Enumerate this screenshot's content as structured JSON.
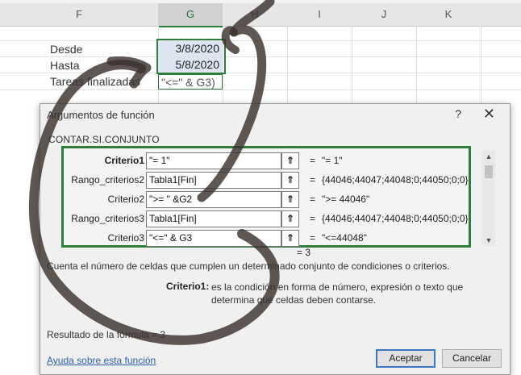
{
  "sheet": {
    "columns": [
      "F",
      "G",
      "H",
      "I",
      "J",
      "K"
    ],
    "selected_column": "G",
    "labels": [
      "Desde",
      "Hasta",
      "Tareas finalizadas"
    ],
    "g_values": [
      "3/8/2020",
      "5/8/2020"
    ],
    "g3_formula": "\"<=\" & G3)"
  },
  "dialog": {
    "title": "Argumentos de función",
    "help_glyph": "?",
    "close_glyph": "✕",
    "function_name": "CONTAR.SI.CONJUNTO",
    "args": [
      {
        "label": "Criterio1",
        "bold": true,
        "input": "\"= 1\"",
        "result": "\"= 1\""
      },
      {
        "label": "Rango_criterios2",
        "bold": false,
        "input": "Tabla1[Fin]",
        "result": "{44046;44047;44048;0;44050;0;0}"
      },
      {
        "label": "Criterio2",
        "bold": false,
        "input": "\">= \" &G2",
        "result": "\">= 44046\""
      },
      {
        "label": "Rango_criterios3",
        "bold": false,
        "input": "Tabla1[Fin]",
        "result": "{44046;44047;44048;0;44050;0;0}"
      },
      {
        "label": "Criterio3",
        "bold": false,
        "input": "\"<=\" & G3",
        "result": "\"<=44048\""
      }
    ],
    "ref_button_glyph": "⇑",
    "equals": "=",
    "total": "= 3",
    "description": "Cuenta el número de celdas que cumplen un determinado conjunto de condiciones o criterios.",
    "arg_desc_label": "Criterio1:",
    "arg_desc_text": "es la condición en forma de número, expresión o texto que determina qué celdas deben contarse.",
    "result_text": "Resultado de la fórmula =   3",
    "help_link": "Ayuda sobre esta función",
    "ok_label": "Aceptar",
    "cancel_label": "Cancelar",
    "scroll_up_glyph": "▲",
    "scroll_down_glyph": "▼"
  },
  "colors": {
    "accent_green": "#2e7d3a",
    "selected_fill": "#dde5f2",
    "link_blue": "#2b5fa8",
    "scribble": "#3a322e"
  }
}
